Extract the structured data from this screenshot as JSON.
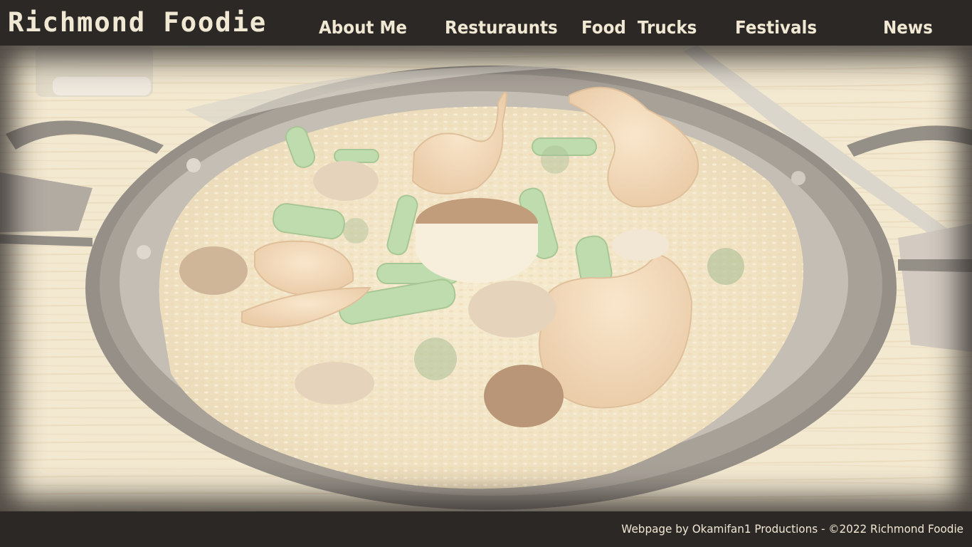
{
  "site": {
    "logo_text": "Richmond Foodie"
  },
  "nav": {
    "items": [
      {
        "label": "About Me"
      },
      {
        "label": "Resturaunts"
      },
      {
        "label": "Food  Trucks"
      },
      {
        "label": "Festivals"
      },
      {
        "label": "News"
      }
    ]
  },
  "hero": {
    "image_subject": "paella-pan-photo"
  },
  "footer": {
    "credit": "Webpage by Okamifan1 Productions - ©2022 Richmond Foodie"
  },
  "colors": {
    "bar_background": "#2b2826",
    "text_cream": "#f1e8d4",
    "photo_wash": "#e9ddc3"
  }
}
